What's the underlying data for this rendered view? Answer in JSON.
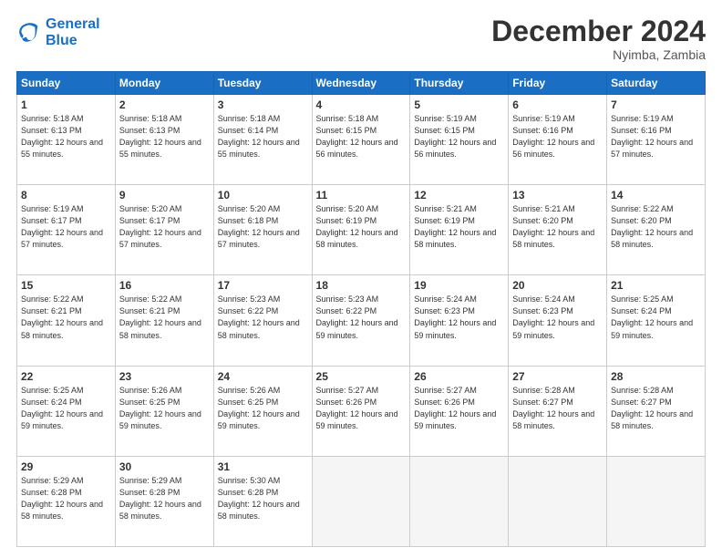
{
  "logo": {
    "line1": "General",
    "line2": "Blue"
  },
  "title": "December 2024",
  "location": "Nyimba, Zambia",
  "days_header": [
    "Sunday",
    "Monday",
    "Tuesday",
    "Wednesday",
    "Thursday",
    "Friday",
    "Saturday"
  ],
  "weeks": [
    [
      {
        "num": "1",
        "sunrise": "5:18 AM",
        "sunset": "6:13 PM",
        "daylight": "12 hours and 55 minutes."
      },
      {
        "num": "2",
        "sunrise": "5:18 AM",
        "sunset": "6:13 PM",
        "daylight": "12 hours and 55 minutes."
      },
      {
        "num": "3",
        "sunrise": "5:18 AM",
        "sunset": "6:14 PM",
        "daylight": "12 hours and 55 minutes."
      },
      {
        "num": "4",
        "sunrise": "5:18 AM",
        "sunset": "6:15 PM",
        "daylight": "12 hours and 56 minutes."
      },
      {
        "num": "5",
        "sunrise": "5:19 AM",
        "sunset": "6:15 PM",
        "daylight": "12 hours and 56 minutes."
      },
      {
        "num": "6",
        "sunrise": "5:19 AM",
        "sunset": "6:16 PM",
        "daylight": "12 hours and 56 minutes."
      },
      {
        "num": "7",
        "sunrise": "5:19 AM",
        "sunset": "6:16 PM",
        "daylight": "12 hours and 57 minutes."
      }
    ],
    [
      {
        "num": "8",
        "sunrise": "5:19 AM",
        "sunset": "6:17 PM",
        "daylight": "12 hours and 57 minutes."
      },
      {
        "num": "9",
        "sunrise": "5:20 AM",
        "sunset": "6:17 PM",
        "daylight": "12 hours and 57 minutes."
      },
      {
        "num": "10",
        "sunrise": "5:20 AM",
        "sunset": "6:18 PM",
        "daylight": "12 hours and 57 minutes."
      },
      {
        "num": "11",
        "sunrise": "5:20 AM",
        "sunset": "6:19 PM",
        "daylight": "12 hours and 58 minutes."
      },
      {
        "num": "12",
        "sunrise": "5:21 AM",
        "sunset": "6:19 PM",
        "daylight": "12 hours and 58 minutes."
      },
      {
        "num": "13",
        "sunrise": "5:21 AM",
        "sunset": "6:20 PM",
        "daylight": "12 hours and 58 minutes."
      },
      {
        "num": "14",
        "sunrise": "5:22 AM",
        "sunset": "6:20 PM",
        "daylight": "12 hours and 58 minutes."
      }
    ],
    [
      {
        "num": "15",
        "sunrise": "5:22 AM",
        "sunset": "6:21 PM",
        "daylight": "12 hours and 58 minutes."
      },
      {
        "num": "16",
        "sunrise": "5:22 AM",
        "sunset": "6:21 PM",
        "daylight": "12 hours and 58 minutes."
      },
      {
        "num": "17",
        "sunrise": "5:23 AM",
        "sunset": "6:22 PM",
        "daylight": "12 hours and 58 minutes."
      },
      {
        "num": "18",
        "sunrise": "5:23 AM",
        "sunset": "6:22 PM",
        "daylight": "12 hours and 59 minutes."
      },
      {
        "num": "19",
        "sunrise": "5:24 AM",
        "sunset": "6:23 PM",
        "daylight": "12 hours and 59 minutes."
      },
      {
        "num": "20",
        "sunrise": "5:24 AM",
        "sunset": "6:23 PM",
        "daylight": "12 hours and 59 minutes."
      },
      {
        "num": "21",
        "sunrise": "5:25 AM",
        "sunset": "6:24 PM",
        "daylight": "12 hours and 59 minutes."
      }
    ],
    [
      {
        "num": "22",
        "sunrise": "5:25 AM",
        "sunset": "6:24 PM",
        "daylight": "12 hours and 59 minutes."
      },
      {
        "num": "23",
        "sunrise": "5:26 AM",
        "sunset": "6:25 PM",
        "daylight": "12 hours and 59 minutes."
      },
      {
        "num": "24",
        "sunrise": "5:26 AM",
        "sunset": "6:25 PM",
        "daylight": "12 hours and 59 minutes."
      },
      {
        "num": "25",
        "sunrise": "5:27 AM",
        "sunset": "6:26 PM",
        "daylight": "12 hours and 59 minutes."
      },
      {
        "num": "26",
        "sunrise": "5:27 AM",
        "sunset": "6:26 PM",
        "daylight": "12 hours and 59 minutes."
      },
      {
        "num": "27",
        "sunrise": "5:28 AM",
        "sunset": "6:27 PM",
        "daylight": "12 hours and 58 minutes."
      },
      {
        "num": "28",
        "sunrise": "5:28 AM",
        "sunset": "6:27 PM",
        "daylight": "12 hours and 58 minutes."
      }
    ],
    [
      {
        "num": "29",
        "sunrise": "5:29 AM",
        "sunset": "6:28 PM",
        "daylight": "12 hours and 58 minutes."
      },
      {
        "num": "30",
        "sunrise": "5:29 AM",
        "sunset": "6:28 PM",
        "daylight": "12 hours and 58 minutes."
      },
      {
        "num": "31",
        "sunrise": "5:30 AM",
        "sunset": "6:28 PM",
        "daylight": "12 hours and 58 minutes."
      },
      null,
      null,
      null,
      null
    ]
  ]
}
